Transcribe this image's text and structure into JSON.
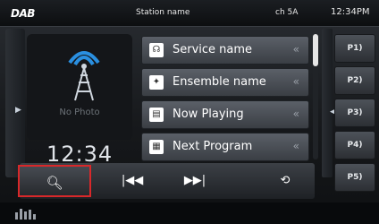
{
  "status_bar": {
    "source": "DAB",
    "station": "Station name",
    "channel": "ch 5A",
    "time": "12:34PM"
  },
  "art": {
    "no_photo": "No Photo",
    "clock": "12:34"
  },
  "info_list": [
    {
      "label": "Service name",
      "icon": "speaker-icon"
    },
    {
      "label": "Ensemble name",
      "icon": "group-icon"
    },
    {
      "label": "Now Playing",
      "icon": "now-icon"
    },
    {
      "label": "Next Program",
      "icon": "program-icon"
    }
  ],
  "presets": [
    "P1)",
    "P2)",
    "P3)",
    "P4)",
    "P5)"
  ],
  "controls": {
    "search": "search-icon",
    "prev": "skip-back-icon",
    "next": "skip-forward-icon",
    "repeat": "repeat-icon"
  },
  "colors": {
    "highlight": "#d8282a"
  }
}
